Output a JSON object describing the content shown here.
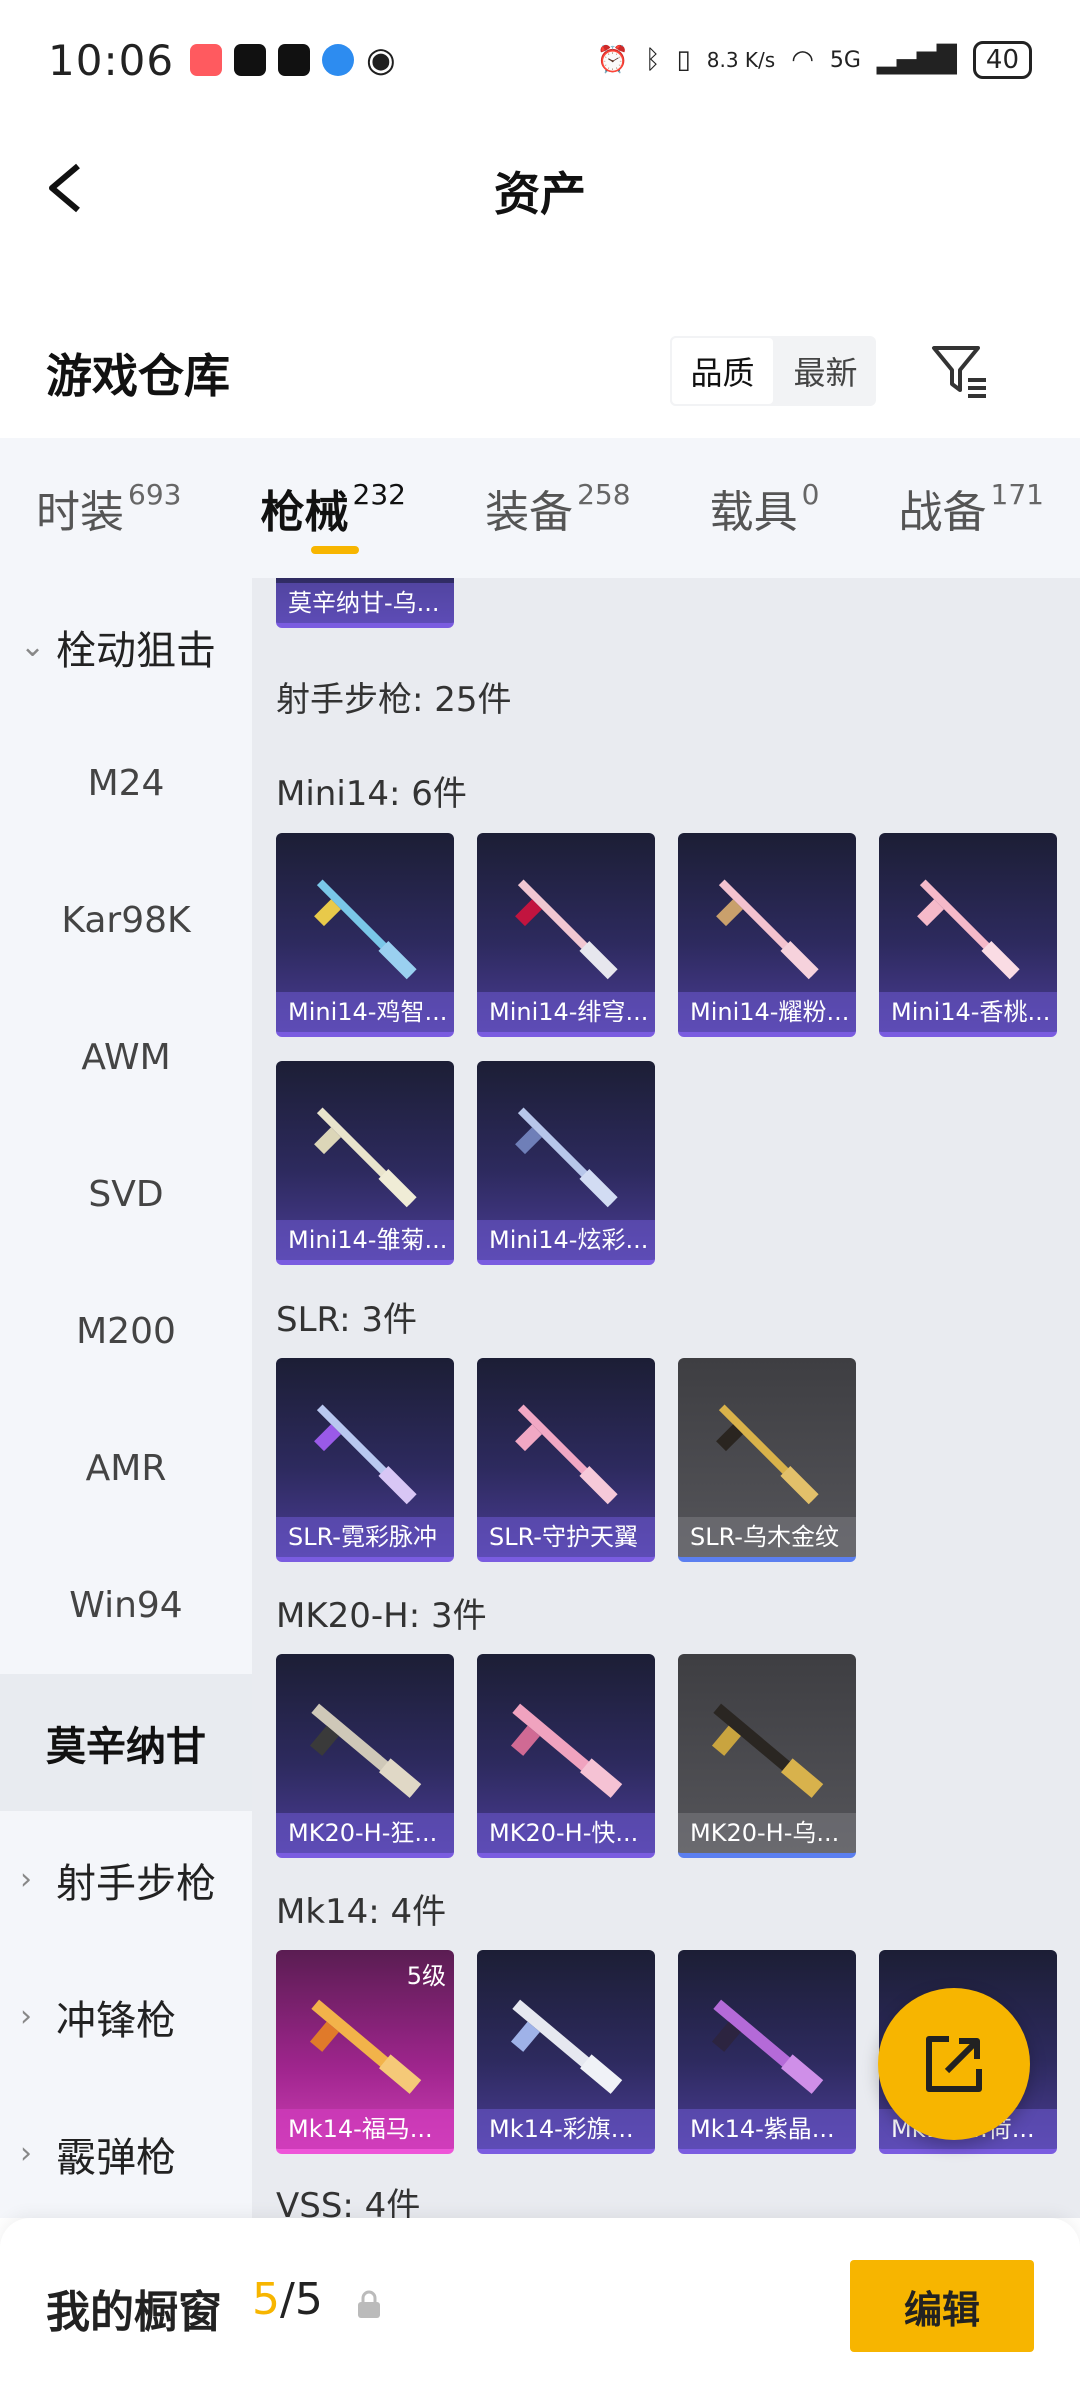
{
  "status_bar": {
    "time": "10:06",
    "net_speed": "8.3 K/s",
    "network": "5G",
    "battery": "40"
  },
  "header": {
    "title": "资产"
  },
  "warehouse": {
    "title": "游戏仓库",
    "sort_options": [
      "品质",
      "最新"
    ],
    "active_sort": "品质"
  },
  "tabs": [
    {
      "label": "时装",
      "count": "693"
    },
    {
      "label": "枪械",
      "count": "232"
    },
    {
      "label": "装备",
      "count": "258"
    },
    {
      "label": "载具",
      "count": "0"
    },
    {
      "label": "战备",
      "count": "171"
    }
  ],
  "sidebar": {
    "items": [
      {
        "label": "栓动狙击",
        "type": "group",
        "expanded": true
      },
      {
        "label": "M24"
      },
      {
        "label": "Kar98K"
      },
      {
        "label": "AWM"
      },
      {
        "label": "SVD"
      },
      {
        "label": "M200"
      },
      {
        "label": "AMR"
      },
      {
        "label": "Win94"
      },
      {
        "label": "莫辛纳甘",
        "active": true
      },
      {
        "label": "射手步枪",
        "type": "group"
      },
      {
        "label": "冲锋枪",
        "type": "group"
      },
      {
        "label": "霰弹枪",
        "type": "group"
      }
    ]
  },
  "content": {
    "top_card_label": "莫辛纳甘-乌...",
    "category_summary": "射手步枪: 25件",
    "sections": [
      {
        "title": "Mini14: 6件",
        "items": [
          "Mini14-鸡智...",
          "Mini14-绯穹...",
          "Mini14-耀粉...",
          "Mini14-香桃...",
          "Mini14-雏菊...",
          "Mini14-炫彩..."
        ]
      },
      {
        "title": "SLR: 3件",
        "items": [
          "SLR-霓彩脉冲",
          "SLR-守护天翼",
          "SLR-乌木金纹"
        ]
      },
      {
        "title": "MK20-H: 3件",
        "items": [
          "MK20-H-狂...",
          "MK20-H-快...",
          "MK20-H-乌..."
        ]
      },
      {
        "title": "Mk14: 4件",
        "items": [
          "Mk14-福马...",
          "Mk14-彩旗...",
          "Mk14-紫晶...",
          "Mk14-...荷..."
        ],
        "first_badge": "5级"
      },
      {
        "title": "VSS: 4件"
      }
    ]
  },
  "bottom_bar": {
    "label": "我的橱窗",
    "current": "5",
    "separator": "/",
    "total": "5",
    "edit_label": "编辑"
  },
  "colors": {
    "accent": "#f7b500",
    "card_purple": "#4a3c94",
    "card_gray": "#55555a",
    "card_pink": "#cc3fb4"
  }
}
